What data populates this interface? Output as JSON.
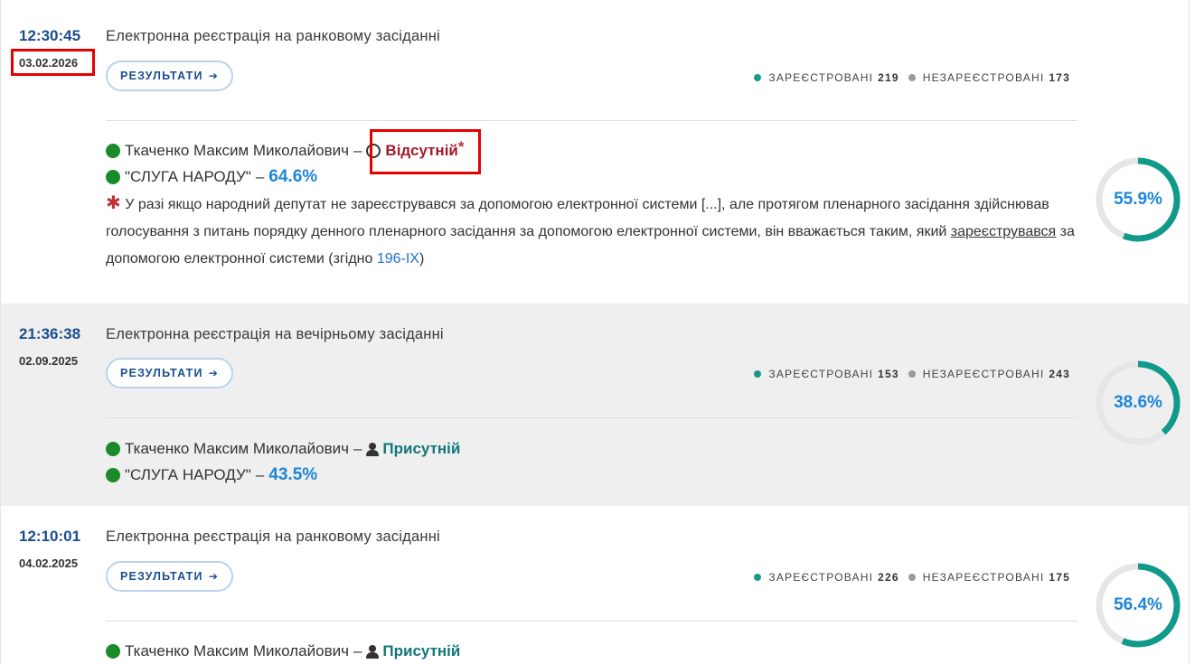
{
  "results_label": "РЕЗУЛЬТАТИ",
  "registered_label": "ЗАРЕЄСТРОВАНІ",
  "unregistered_label": "НЕЗАРЕЄСТРОВАНІ",
  "colors": {
    "ring": "#11998a",
    "ring_track": "#e6e6e6",
    "link": "#1e6fd0",
    "absent": "#a31a2a",
    "present": "#13777a"
  },
  "events": [
    {
      "time": "12:30:45",
      "date": "03.02.2026",
      "title": "Електронна реєстрація на ранковому засіданні",
      "registered": "219",
      "unregistered": "173",
      "deputy": "Ткаченко Максим Миколайович",
      "status": "Відсутній",
      "status_star": "*",
      "faction": "\"СЛУГА НАРОДУ\"",
      "faction_pct": "64.6%",
      "ring_pct_label": "55.9%",
      "ring_fraction": 0.559,
      "note": {
        "star": "✱",
        "text1": "У разі якщо народний депутат не зареєструвався за допомогою електронної системи [...], але протягом пленарного засідання здійснював голосування з питань порядку денного пленарного засідання за допомогою електронної системи, він вважається таким, який ",
        "underlined": "зареєструвався",
        "text2": " за допомогою електронної системи (згідно ",
        "link": "196-IX",
        "text3": ")"
      }
    },
    {
      "time": "21:36:38",
      "date": "02.09.2025",
      "title": "Електронна реєстрація на вечірньому засіданні",
      "registered": "153",
      "unregistered": "243",
      "deputy": "Ткаченко Максим Миколайович",
      "status": "Присутній",
      "faction": "\"СЛУГА НАРОДУ\"",
      "faction_pct": "43.5%",
      "ring_pct_label": "38.6%",
      "ring_fraction": 0.386
    },
    {
      "time": "12:10:01",
      "date": "04.02.2025",
      "title": "Електронна реєстрація на ранковому засіданні",
      "registered": "226",
      "unregistered": "175",
      "deputy": "Ткаченко Максим Миколайович",
      "status": "Присутній",
      "ring_pct_label": "56.4%",
      "ring_fraction": 0.564
    }
  ]
}
